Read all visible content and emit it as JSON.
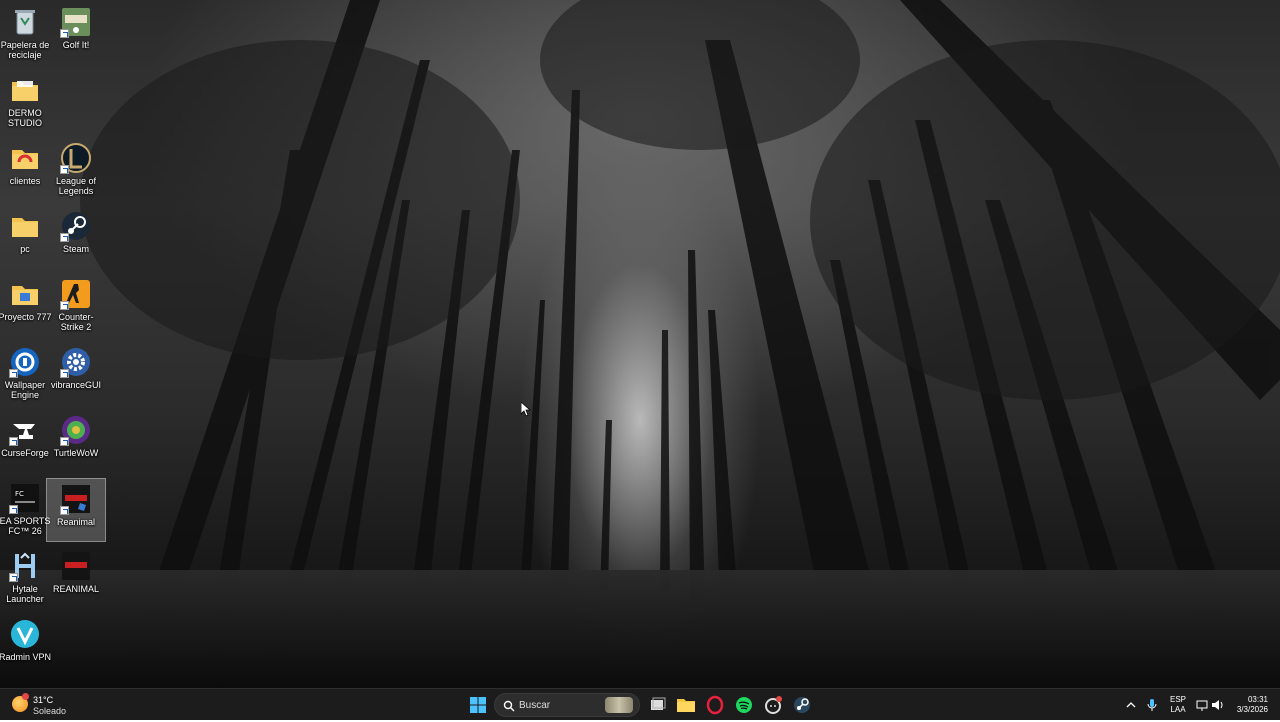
{
  "desktop": {
    "icons": [
      {
        "label": "Papelera de reciclaje",
        "icon": "recycle-bin-icon"
      },
      {
        "label": "Golf It!",
        "icon": "golf-it-icon"
      },
      {
        "label": "DERMO STUDIO",
        "icon": "folder-icon"
      },
      {
        "label": "clientes",
        "icon": "folder-red-icon"
      },
      {
        "label": "League of Legends",
        "icon": "league-of-legends-icon"
      },
      {
        "label": "pc",
        "icon": "folder-icon"
      },
      {
        "label": "Steam",
        "icon": "steam-icon"
      },
      {
        "label": "Proyecto 777",
        "icon": "folder-blue-icon"
      },
      {
        "label": "Counter-Strike 2",
        "icon": "counter-strike-icon"
      },
      {
        "label": "Wallpaper Engine",
        "icon": "wallpaper-engine-icon"
      },
      {
        "label": "vibranceGUI",
        "icon": "gear-icon"
      },
      {
        "label": "CurseForge",
        "icon": "curseforge-icon"
      },
      {
        "label": "TurtleWoW",
        "icon": "turtlewow-icon"
      },
      {
        "label": "EA SPORTS FC™ 26",
        "icon": "ea-sports-fc-icon"
      },
      {
        "label": "Reanimal",
        "icon": "reanimal-icon"
      },
      {
        "label": "Hytale Launcher",
        "icon": "hytale-icon"
      },
      {
        "label": "REANIMAL",
        "icon": "reanimal-icon"
      },
      {
        "label": "Radmin VPN",
        "icon": "radmin-vpn-icon"
      }
    ]
  },
  "taskbar": {
    "weather": {
      "temperature": "31°C",
      "condition": "Soleado",
      "icon": "sun-icon"
    },
    "search": {
      "placeholder": "Buscar",
      "icon": "search-icon"
    },
    "pinned": [
      {
        "name": "Start",
        "icon": "windows-start-icon"
      },
      {
        "name": "Task View",
        "icon": "task-view-icon"
      },
      {
        "name": "File Explorer",
        "icon": "file-explorer-icon"
      },
      {
        "name": "Opera GX",
        "icon": "opera-gx-icon"
      },
      {
        "name": "Spotify",
        "icon": "spotify-icon"
      },
      {
        "name": "Discord",
        "icon": "discord-icon"
      },
      {
        "name": "Steam",
        "icon": "steam-icon"
      }
    ],
    "tray": {
      "language": {
        "line1": "ESP",
        "line2": "LAA"
      },
      "clock": {
        "time": "03:31",
        "date": "3/3/2026"
      }
    }
  },
  "colors": {
    "taskbar_bg": "#1c1c1c",
    "accent": "#0a84ff"
  }
}
